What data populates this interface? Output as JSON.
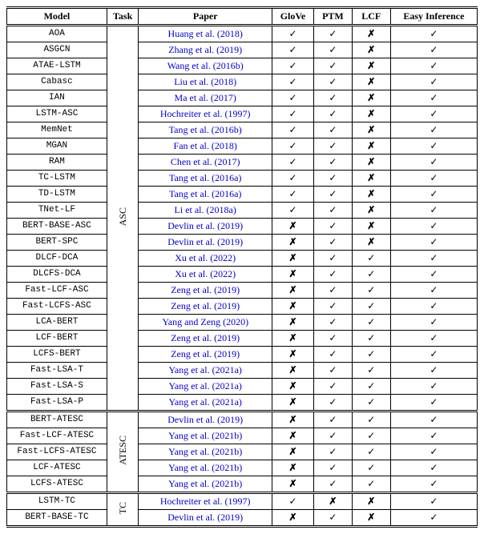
{
  "headers": {
    "model": "Model",
    "task": "Task",
    "paper": "Paper",
    "glove": "GloVe",
    "ptm": "PTM",
    "lcf": "LCF",
    "easy": "Easy Inference"
  },
  "tasks": {
    "asc": "ASC",
    "atesc": "ATESC",
    "tc": "TC"
  },
  "marks": {
    "yes": "✓",
    "no": "✗"
  },
  "groups": [
    {
      "task_key": "asc",
      "rows": [
        {
          "model": "AOA",
          "paper": "Huang et al. (2018)",
          "glove": "yes",
          "ptm": "yes",
          "lcf": "no",
          "easy": "yes"
        },
        {
          "model": "ASGCN",
          "paper": "Zhang et al. (2019)",
          "glove": "yes",
          "ptm": "yes",
          "lcf": "no",
          "easy": "yes"
        },
        {
          "model": "ATAE-LSTM",
          "paper": "Wang et al. (2016b)",
          "glove": "yes",
          "ptm": "yes",
          "lcf": "no",
          "easy": "yes"
        },
        {
          "model": "Cabasc",
          "paper": "Liu et al. (2018)",
          "glove": "yes",
          "ptm": "yes",
          "lcf": "no",
          "easy": "yes"
        },
        {
          "model": "IAN",
          "paper": "Ma et al. (2017)",
          "glove": "yes",
          "ptm": "yes",
          "lcf": "no",
          "easy": "yes"
        },
        {
          "model": "LSTM-ASC",
          "paper": "Hochreiter et al. (1997)",
          "glove": "yes",
          "ptm": "yes",
          "lcf": "no",
          "easy": "yes"
        },
        {
          "model": "MemNet",
          "paper": "Tang et al. (2016b)",
          "glove": "yes",
          "ptm": "yes",
          "lcf": "no",
          "easy": "yes"
        },
        {
          "model": "MGAN",
          "paper": "Fan et al. (2018)",
          "glove": "yes",
          "ptm": "yes",
          "lcf": "no",
          "easy": "yes"
        },
        {
          "model": "RAM",
          "paper": "Chen et al. (2017)",
          "glove": "yes",
          "ptm": "yes",
          "lcf": "no",
          "easy": "yes"
        },
        {
          "model": "TC-LSTM",
          "paper": "Tang et al. (2016a)",
          "glove": "yes",
          "ptm": "yes",
          "lcf": "no",
          "easy": "yes"
        },
        {
          "model": "TD-LSTM",
          "paper": "Tang et al. (2016a)",
          "glove": "yes",
          "ptm": "yes",
          "lcf": "no",
          "easy": "yes"
        },
        {
          "model": "TNet-LF",
          "paper": "Li et al. (2018a)",
          "glove": "yes",
          "ptm": "yes",
          "lcf": "no",
          "easy": "yes"
        },
        {
          "model": "BERT-BASE-ASC",
          "paper": "Devlin et al. (2019)",
          "glove": "no",
          "ptm": "yes",
          "lcf": "no",
          "easy": "yes"
        },
        {
          "model": "BERT-SPC",
          "paper": "Devlin et al. (2019)",
          "glove": "no",
          "ptm": "yes",
          "lcf": "no",
          "easy": "yes"
        },
        {
          "model": "DLCF-DCA",
          "paper": "Xu et al. (2022)",
          "glove": "no",
          "ptm": "yes",
          "lcf": "yes",
          "easy": "yes"
        },
        {
          "model": "DLCFS-DCA",
          "paper": "Xu et al. (2022)",
          "glove": "no",
          "ptm": "yes",
          "lcf": "yes",
          "easy": "yes"
        },
        {
          "model": "Fast-LCF-ASC",
          "paper": "Zeng et al. (2019)",
          "glove": "no",
          "ptm": "yes",
          "lcf": "yes",
          "easy": "yes"
        },
        {
          "model": "Fast-LCFS-ASC",
          "paper": "Zeng et al. (2019)",
          "glove": "no",
          "ptm": "yes",
          "lcf": "yes",
          "easy": "yes"
        },
        {
          "model": "LCA-BERT",
          "paper": "Yang and Zeng (2020)",
          "glove": "no",
          "ptm": "yes",
          "lcf": "yes",
          "easy": "yes"
        },
        {
          "model": "LCF-BERT",
          "paper": "Zeng et al. (2019)",
          "glove": "no",
          "ptm": "yes",
          "lcf": "yes",
          "easy": "yes"
        },
        {
          "model": "LCFS-BERT",
          "paper": "Zeng et al. (2019)",
          "glove": "no",
          "ptm": "yes",
          "lcf": "yes",
          "easy": "yes"
        },
        {
          "model": "Fast-LSA-T",
          "paper": "Yang et al. (2021a)",
          "glove": "no",
          "ptm": "yes",
          "lcf": "yes",
          "easy": "yes"
        },
        {
          "model": "Fast-LSA-S",
          "paper": "Yang et al. (2021a)",
          "glove": "no",
          "ptm": "yes",
          "lcf": "yes",
          "easy": "yes"
        },
        {
          "model": "Fast-LSA-P",
          "paper": "Yang et al. (2021a)",
          "glove": "no",
          "ptm": "yes",
          "lcf": "yes",
          "easy": "yes"
        }
      ]
    },
    {
      "task_key": "atesc",
      "rows": [
        {
          "model": "BERT-ATESC",
          "paper": "Devlin et al. (2019)",
          "glove": "no",
          "ptm": "yes",
          "lcf": "yes",
          "easy": "yes"
        },
        {
          "model": "Fast-LCF-ATESC",
          "paper": "Yang et al. (2021b)",
          "glove": "no",
          "ptm": "yes",
          "lcf": "yes",
          "easy": "yes"
        },
        {
          "model": "Fast-LCFS-ATESC",
          "paper": "Yang et al. (2021b)",
          "glove": "no",
          "ptm": "yes",
          "lcf": "yes",
          "easy": "yes"
        },
        {
          "model": "LCF-ATESC",
          "paper": "Yang et al. (2021b)",
          "glove": "no",
          "ptm": "yes",
          "lcf": "yes",
          "easy": "yes"
        },
        {
          "model": "LCFS-ATESC",
          "paper": "Yang et al. (2021b)",
          "glove": "no",
          "ptm": "yes",
          "lcf": "yes",
          "easy": "yes"
        }
      ]
    },
    {
      "task_key": "tc",
      "rows": [
        {
          "model": "LSTM-TC",
          "paper": "Hochreiter et al. (1997)",
          "glove": "yes",
          "ptm": "no",
          "lcf": "no",
          "easy": "yes"
        },
        {
          "model": "BERT-BASE-TC",
          "paper": "Devlin et al. (2019)",
          "glove": "no",
          "ptm": "yes",
          "lcf": "no",
          "easy": "yes"
        }
      ]
    }
  ]
}
